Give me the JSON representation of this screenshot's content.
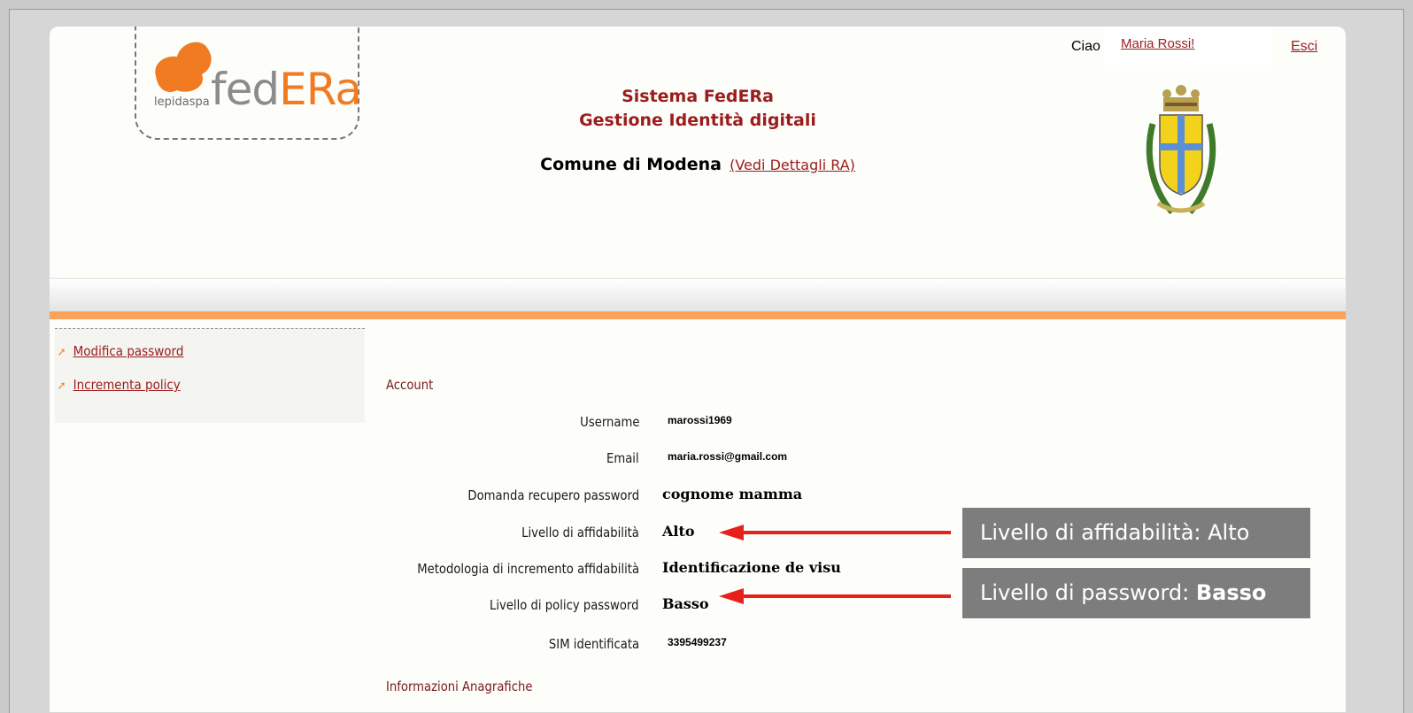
{
  "header": {
    "logo": {
      "brand_prefix": "fed",
      "brand_accent": "ERa",
      "sub": "lepidaspa"
    },
    "title_line1": "Sistema FedERa",
    "title_line2": "Gestione Identità digitali",
    "comune": "Comune di Modena",
    "comune_link": "(Vedi Dettagli RA)",
    "greeting": "Ciao",
    "user": "Maria Rossi!",
    "logout": "Esci",
    "crest_icon": "coat-of-arms-icon"
  },
  "sidebar": {
    "items": [
      {
        "label": "Modifica password",
        "icon": "arrow-bullet-icon"
      },
      {
        "label": "Incrementa policy",
        "icon": "arrow-bullet-icon"
      }
    ]
  },
  "account": {
    "title": "Account",
    "rows": [
      {
        "label": "Username",
        "value": "marossi1969"
      },
      {
        "label": "Email",
        "value": "maria.rossi@gmail.com"
      },
      {
        "label": "Domanda recupero password",
        "value": "cognome mamma"
      },
      {
        "label": "Livello di affidabilità",
        "value": "Alto"
      },
      {
        "label": "Metodologia di incremento affidabilità",
        "value": "Identificazione de visu"
      },
      {
        "label": "Livello di policy password",
        "value": "Basso"
      },
      {
        "label": "SIM identificata",
        "value": "3395499237"
      }
    ]
  },
  "anagrafica": {
    "title": "Informazioni Anagrafiche"
  },
  "annotations": {
    "affidabilita": "Livello di affidabilità: Alto",
    "password_prefix": "Livello di password: ",
    "password_value": "Basso",
    "arrow_color": "#e8201c"
  },
  "colors": {
    "brand_orange": "#f07b22",
    "title_red": "#9b1c1c",
    "orange_bar": "#f9a35a",
    "callout_gray": "#7d7d7d"
  }
}
